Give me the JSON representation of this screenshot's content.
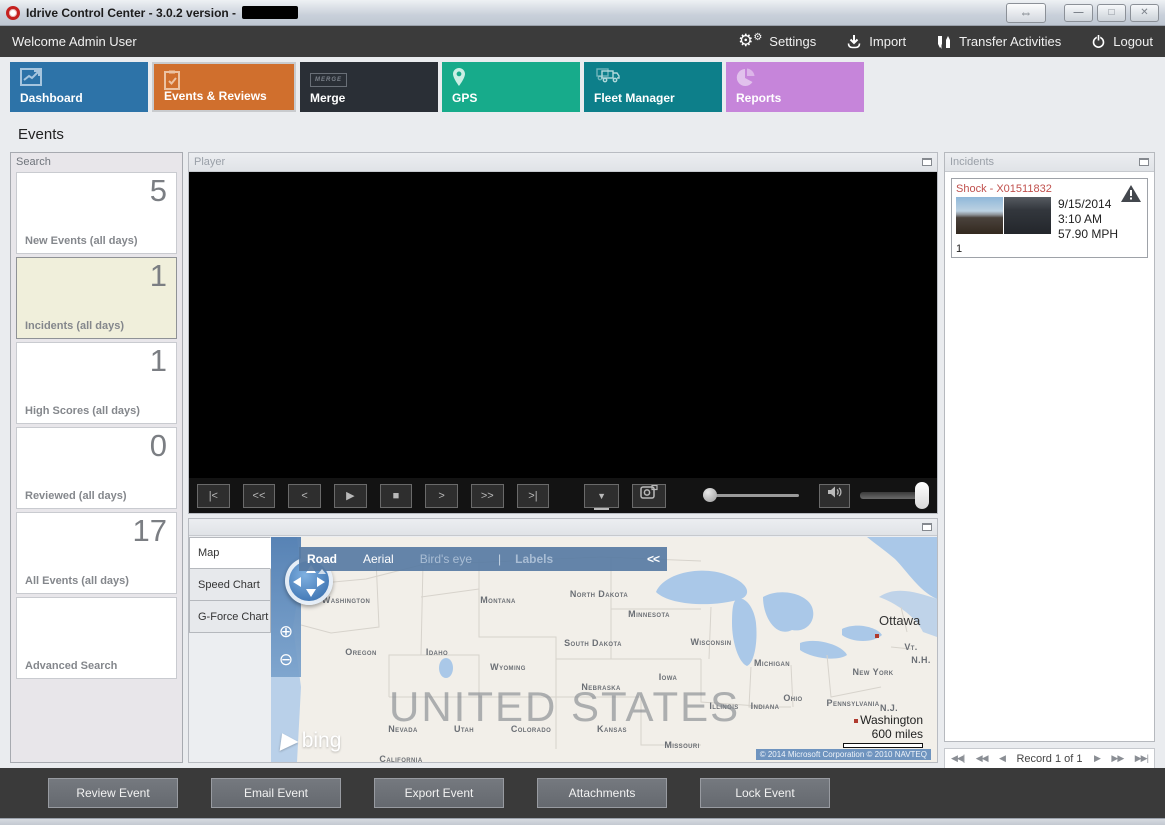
{
  "window": {
    "title": "Idrive Control Center - 3.0.2 version -",
    "controls": {
      "resize": "⇔",
      "minimize": "—",
      "maximize": "□",
      "close": "✕"
    }
  },
  "menubar": {
    "welcome": "Welcome Admin User",
    "actions": {
      "settings": "Settings",
      "import": "Import",
      "transfer": "Transfer Activities",
      "logout": "Logout"
    }
  },
  "tabs": {
    "dashboard": "Dashboard",
    "events": "Events & Reviews",
    "merge": "Merge",
    "merge_icon_text": "MERGE",
    "gps": "GPS",
    "fleet": "Fleet Manager",
    "reports": "Reports"
  },
  "page_title": "Events",
  "sidebar": {
    "title": "Search",
    "cards": [
      {
        "count": "5",
        "label": "New Events (all days)"
      },
      {
        "count": "1",
        "label": "Incidents (all days)"
      },
      {
        "count": "1",
        "label": "High Scores (all days)"
      },
      {
        "count": "0",
        "label": "Reviewed (all days)"
      },
      {
        "count": "17",
        "label": "All Events (all days)"
      },
      {
        "count": "",
        "label": "Advanced Search"
      }
    ]
  },
  "player": {
    "title": "Player",
    "controls": {
      "first": "|<",
      "rew": "<<",
      "prev": "<",
      "play": "▶",
      "stop": "■",
      "next": ">",
      "ffwd": ">>",
      "last": ">|",
      "download": "▼"
    }
  },
  "incidents": {
    "title": "Incidents",
    "event": {
      "title": "Shock - X01511832",
      "date": "9/15/2014",
      "time": "3:10 AM",
      "speed": "57.90 MPH",
      "count": "1"
    }
  },
  "map_panel": {
    "tabs": {
      "map": "Map",
      "speed": "Speed Chart",
      "gforce": "G-Force Chart"
    },
    "toolbar": {
      "road": "Road",
      "aerial": "Aerial",
      "birdseye": "Bird's eye",
      "labels": "Labels",
      "divider": "|",
      "collapse": "<<"
    },
    "zoom": {
      "in": "⊕",
      "out": "⊖"
    },
    "watermark": "UNITED STATES",
    "states": [
      "Washington",
      "Montana",
      "North Dakota",
      "Minnesota",
      "Oregon",
      "Idaho",
      "Wyoming",
      "South Dakota",
      "Wisconsin",
      "Michigan",
      "Iowa",
      "Nebraska",
      "New York",
      "Vt.",
      "N.H.",
      "Illinois",
      "Indiana",
      "Ohio",
      "Pennsylvania",
      "N.J.",
      "Nevada",
      "Utah",
      "Colorado",
      "Kansas",
      "Missouri",
      "California"
    ],
    "cities": {
      "ottawa": "Ottawa",
      "washington": "Washington"
    },
    "scale": "600 miles",
    "logo": "bing",
    "copyright": "© 2014 Microsoft Corporation  © 2010 NAVTEQ"
  },
  "record_nav": {
    "first": "◀◀|",
    "prev_page": "◀◀",
    "prev": "◀",
    "label": "Record 1 of 1",
    "next": "▶",
    "next_page": "▶▶",
    "last": "▶▶|"
  },
  "footer": {
    "buttons": [
      "Review Event",
      "Email Event",
      "Export Event",
      "Attachments",
      "Lock Event"
    ]
  },
  "colors": {
    "dashboard_tab": "#2d73a8",
    "events_tab": "#d06f2d",
    "merge_tab": "#2a2f36",
    "gps_tab": "#17ab8b",
    "fleet_tab": "#0d7f8a",
    "reports_tab": "#c685da",
    "selected_card_bg": "#f0efdb",
    "incident_title_red": "#c0504d",
    "menubar_bg": "#3b3b3b"
  }
}
